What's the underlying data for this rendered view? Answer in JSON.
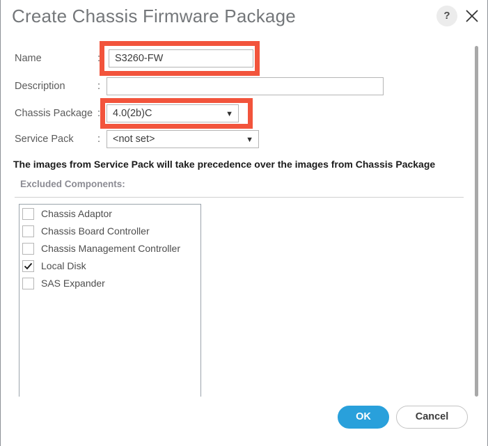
{
  "dialog": {
    "title": "Create Chassis Firmware Package",
    "help_icon": "question-mark-icon",
    "close_icon": "close-icon"
  },
  "form": {
    "colon": ":",
    "fields": [
      {
        "label": "Name",
        "value": "S3260-FW",
        "type": "text",
        "highlighted": true
      },
      {
        "label": "Description",
        "value": "",
        "type": "text",
        "highlighted": false
      },
      {
        "label": "Chassis Package",
        "value": "4.0(2b)C",
        "type": "select",
        "highlighted": true
      },
      {
        "label": "Service Pack",
        "value": "<not set>",
        "type": "select",
        "highlighted": false
      }
    ],
    "caret": "▼"
  },
  "notice": "The images from Service Pack will take precedence over the images from Chassis Package",
  "excluded": {
    "header": "Excluded Components:",
    "items": [
      {
        "label": "Chassis Adaptor",
        "checked": false
      },
      {
        "label": "Chassis Board Controller",
        "checked": false
      },
      {
        "label": "Chassis Management Controller",
        "checked": false
      },
      {
        "label": "Local Disk",
        "checked": true
      },
      {
        "label": "SAS Expander",
        "checked": false
      }
    ]
  },
  "footer": {
    "ok_label": "OK",
    "cancel_label": "Cancel"
  },
  "colors": {
    "accent_blue": "#29a0db",
    "annotation_red": "#f2543c",
    "title_gray": "#74777a"
  }
}
